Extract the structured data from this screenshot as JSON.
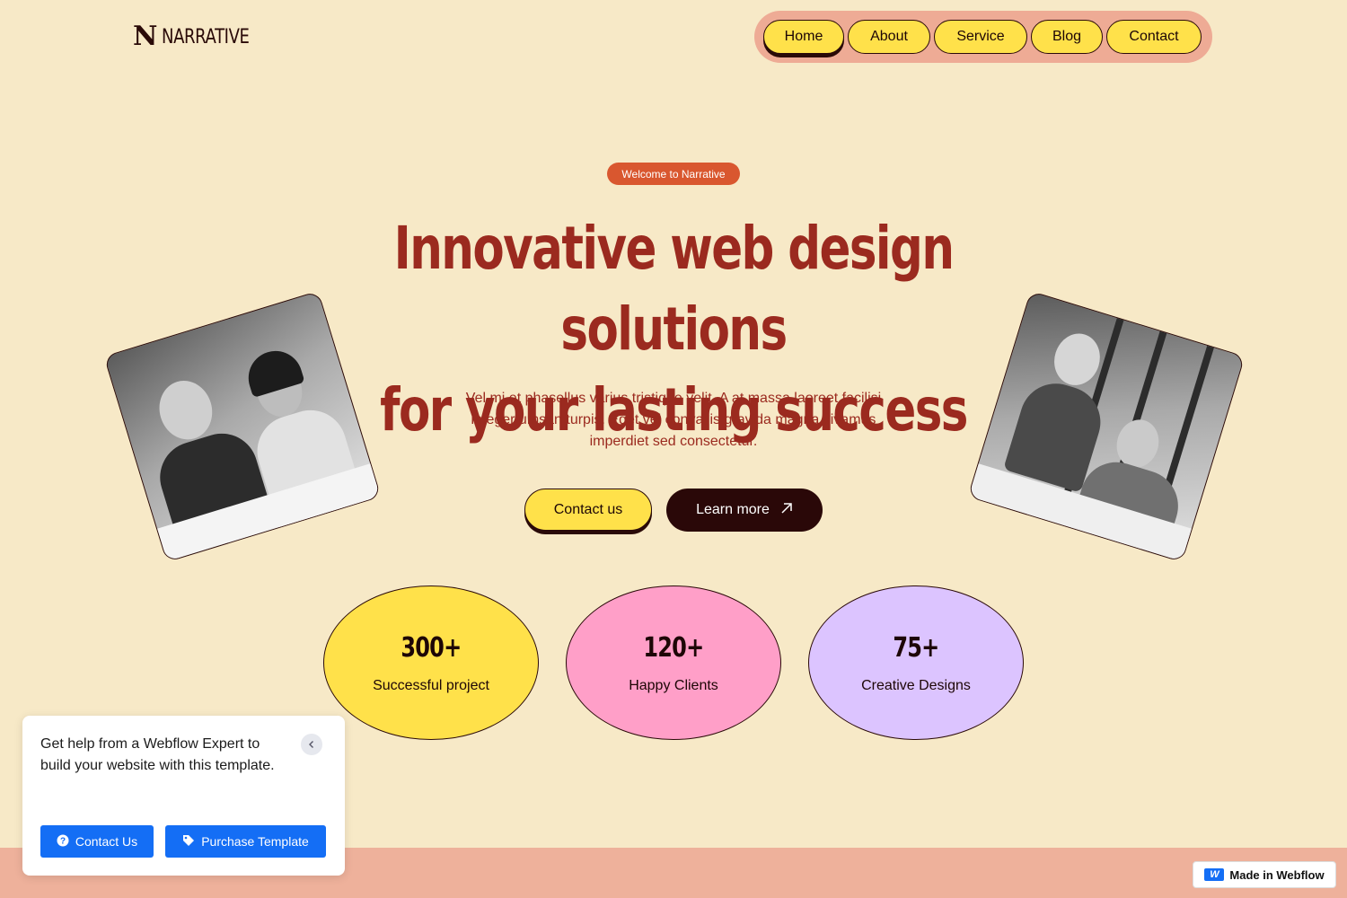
{
  "brand": {
    "logo_mark": "N",
    "name": "NARRATIVE"
  },
  "nav": {
    "items": [
      {
        "label": "Home",
        "active": true
      },
      {
        "label": "About"
      },
      {
        "label": "Service"
      },
      {
        "label": "Blog"
      },
      {
        "label": "Contact"
      }
    ]
  },
  "hero": {
    "badge": "Welcome to Narrative",
    "headline_line1": "Innovative web design solutions",
    "headline_line2": "for your lasting success",
    "subtext": "Vel mi et phasellus varius tristique velit. A at massa laoreet facilisi integer umsan turpis. Eget vel convallis gravida magna vivamus imperdiet sed consectetur.",
    "primary_button": "Contact us",
    "secondary_button": "Learn more",
    "secondary_icon": "arrow-up-right-icon"
  },
  "stats": [
    {
      "value": "300+",
      "label": "Successful project",
      "color": "#ffe14a"
    },
    {
      "value": "120+",
      "label": "Happy Clients",
      "color": "#ff9fc8"
    },
    {
      "value": "75+",
      "label": "Creative Designs",
      "color": "#dcc4ff"
    }
  ],
  "help_popup": {
    "text": "Get help from a Webflow Expert to build your website with this template.",
    "contact_button": "Contact Us",
    "purchase_button": "Purchase Template",
    "close_icon": "chevron-left-icon"
  },
  "webflow_badge": {
    "label": "Made in Webflow"
  },
  "colors": {
    "background": "#f7e9c7",
    "accent_red": "#9b2a1f",
    "nav_pill": "#eeab95",
    "button_yellow": "#ffe14a",
    "dark": "#2a0808",
    "webflow_blue": "#146ef5"
  }
}
